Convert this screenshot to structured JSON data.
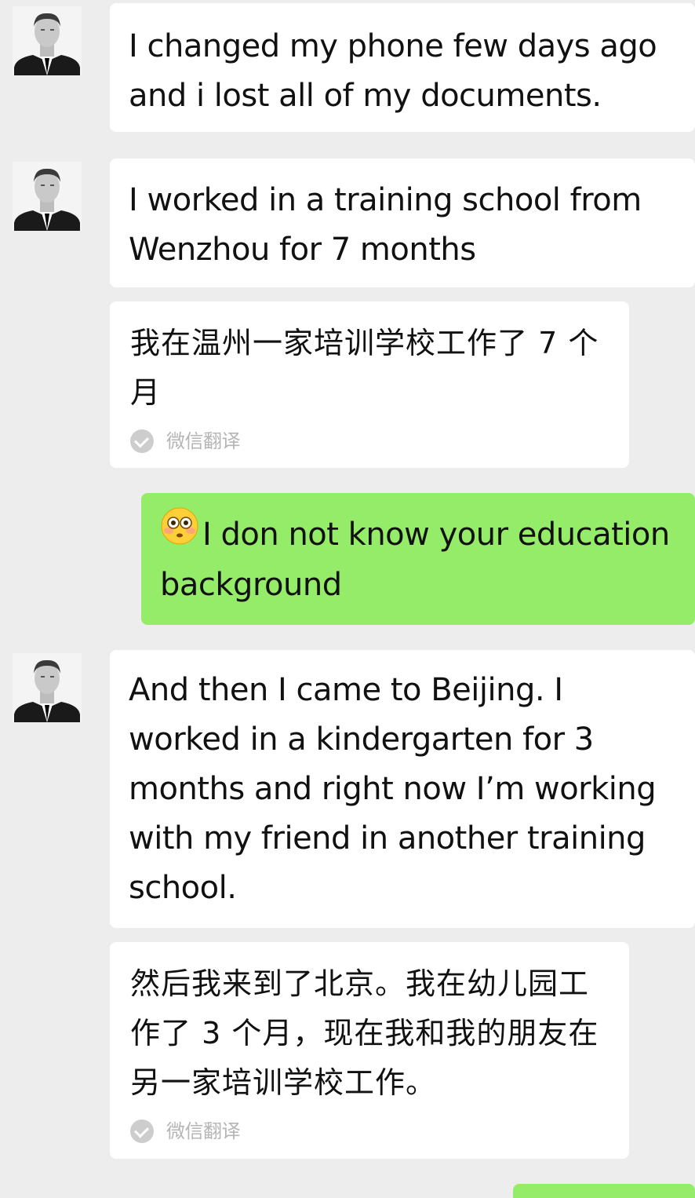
{
  "messages": [
    {
      "id": "m1",
      "text": "I changed my phone few days ago and i lost all of my documents."
    },
    {
      "id": "m2",
      "text": "I worked in a training school from Wenzhou for 7 months"
    },
    {
      "id": "m2t",
      "text": "我在温州一家培训学校工作了 7 个月",
      "tag": "微信翻译"
    },
    {
      "id": "m3",
      "emoji": "flushed-face-emoji",
      "text": "I don not know your education background"
    },
    {
      "id": "m4",
      "text": "And then I came to Beijing. I worked in a kindergarten for 3 months and right now I’m working with my friend in another training school."
    },
    {
      "id": "m4t",
      "text": "然后我来到了北京。我在幼儿园工作了 3 个月，现在我和我的朋友在另一家培训学校工作。",
      "tag": "微信翻译"
    }
  ],
  "colors": {
    "background": "#ededed",
    "incoming_bubble": "#ffffff",
    "outgoing_bubble": "#95ec69",
    "tag_text": "#b5b5b5"
  },
  "icons": [
    "avatar",
    "check-icon",
    "flushed-face-emoji"
  ]
}
